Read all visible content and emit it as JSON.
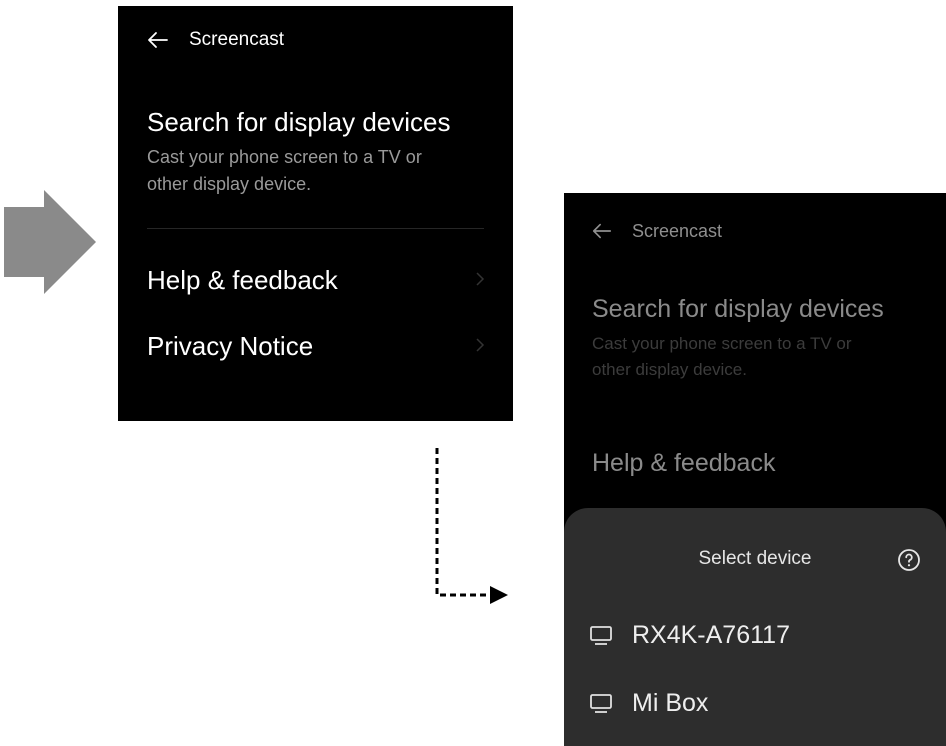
{
  "left_screen": {
    "header": {
      "back_icon": "arrow-left-icon",
      "title": "Screencast"
    },
    "search": {
      "title": "Search for display devices",
      "desc_line1": "Cast your phone screen to a TV or",
      "desc_line2": "other display device."
    },
    "items": [
      {
        "label": "Help & feedback",
        "icon": "chevron-right-icon"
      },
      {
        "label": "Privacy Notice",
        "icon": "chevron-right-icon"
      }
    ]
  },
  "right_screen": {
    "header": {
      "back_icon": "arrow-left-icon",
      "title": "Screencast"
    },
    "search": {
      "title": "Search for display devices",
      "desc_line1": "Cast your phone screen to a TV or",
      "desc_line2": "other display device."
    },
    "items": [
      {
        "label": "Help & feedback"
      }
    ],
    "sheet": {
      "title": "Select device",
      "help_icon": "help-circle-icon",
      "devices": [
        {
          "label": "RX4K-A76117",
          "icon": "monitor-icon"
        },
        {
          "label": "Mi Box",
          "icon": "monitor-icon"
        }
      ]
    }
  },
  "annotations": {
    "big_arrow_icon": "arrow-right-icon",
    "flow_arrow_icon": "dashed-arrow-icon"
  },
  "colors": {
    "screen_bg": "#000000",
    "sheet_bg": "#2d2d2d",
    "arrow_gray": "#8a8a8a"
  }
}
